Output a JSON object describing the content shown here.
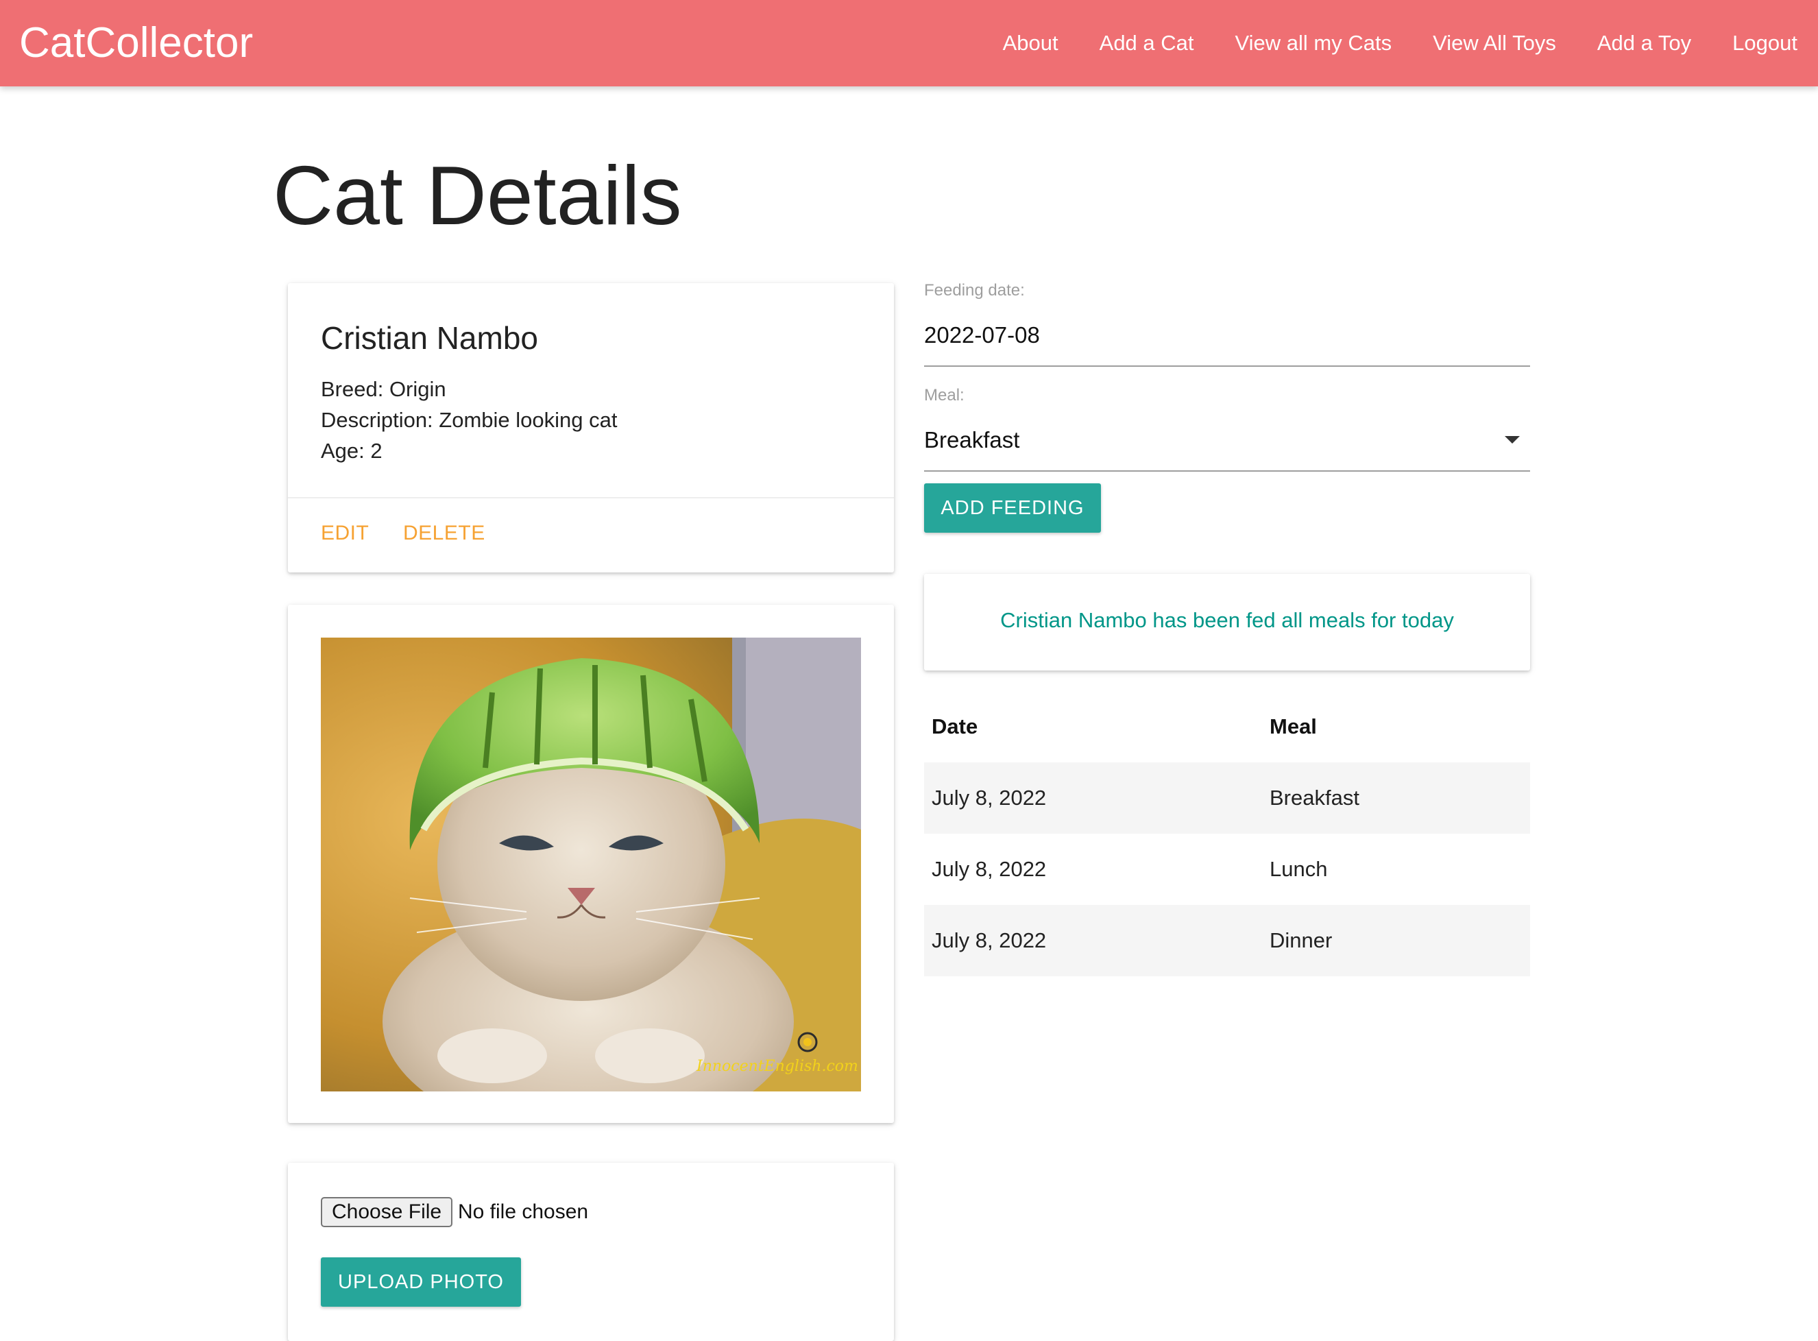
{
  "navbar": {
    "brand": "CatCollector",
    "links": [
      "About",
      "Add a Cat",
      "View all my Cats",
      "View All Toys",
      "Add a Toy",
      "Logout"
    ]
  },
  "page": {
    "title": "Cat Details"
  },
  "cat": {
    "name": "Cristian Nambo",
    "breed": "Breed: Origin",
    "description": "Description: Zombie looking cat",
    "age": "Age: 2",
    "actions": {
      "edit": "EDIT",
      "delete": "DELETE"
    },
    "photo_watermark": "InnocentEnglish.com"
  },
  "upload": {
    "choose_file_label": "Choose File",
    "file_status": "No file chosen",
    "upload_button": "UPLOAD PHOTO"
  },
  "feeding_form": {
    "date_label": "Feeding date:",
    "date_value": "2022-07-08",
    "meal_label": "Meal:",
    "meal_value": "Breakfast",
    "submit_label": "ADD FEEDING"
  },
  "status_message": "Cristian Nambo has been fed all meals for today",
  "feedings_table": {
    "headers": [
      "Date",
      "Meal"
    ],
    "rows": [
      [
        "July 8, 2022",
        "Breakfast"
      ],
      [
        "July 8, 2022",
        "Lunch"
      ],
      [
        "July 8, 2022",
        "Dinner"
      ]
    ]
  },
  "colors": {
    "navbar": "#ef6f73",
    "accent_teal": "#26a69a",
    "action_orange": "#f6a233",
    "status_text": "#009688"
  }
}
